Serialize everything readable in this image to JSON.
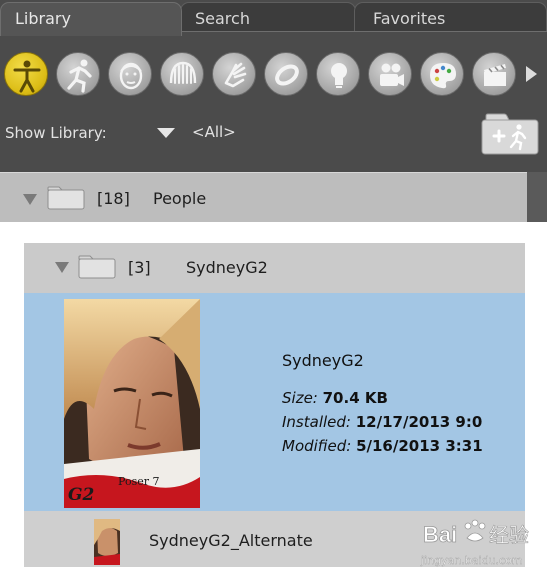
{
  "tabs": [
    {
      "label": "Library",
      "active": true
    },
    {
      "label": "Search",
      "active": false
    },
    {
      "label": "Favorites",
      "active": false
    }
  ],
  "categories": [
    {
      "name": "figures",
      "icon": "figure-icon",
      "active": true
    },
    {
      "name": "poses",
      "icon": "running-pose-icon",
      "active": false
    },
    {
      "name": "expressions",
      "icon": "face-icon",
      "active": false
    },
    {
      "name": "hair",
      "icon": "hair-icon",
      "active": false
    },
    {
      "name": "hands",
      "icon": "hand-icon",
      "active": false
    },
    {
      "name": "props",
      "icon": "ring-prop-icon",
      "active": false
    },
    {
      "name": "lights",
      "icon": "lightbulb-icon",
      "active": false
    },
    {
      "name": "cameras",
      "icon": "camera-icon",
      "active": false
    },
    {
      "name": "materials",
      "icon": "palette-icon",
      "active": false
    },
    {
      "name": "scenes",
      "icon": "clapperboard-icon",
      "active": false
    }
  ],
  "show_library": {
    "label": "Show Library:",
    "value": "<All>"
  },
  "people_folder": {
    "count": "[18]",
    "name": "People"
  },
  "sydney_folder": {
    "count": "[3]",
    "name": "SydneyG2"
  },
  "selected_item": {
    "name": "SydneyG2",
    "size_label": "Size",
    "size_value": "70.4 KB",
    "installed_label": "Installed",
    "installed_value": "12/17/2013 9:0",
    "modified_label": "Modified",
    "modified_value": "5/16/2013 3:31",
    "thumbnail_caption": "Poser 7",
    "thumbnail_logo": "G2"
  },
  "alternate_item": {
    "name": "SydneyG2_Alternate"
  },
  "watermark": {
    "brand": "Bai",
    "brand_cn": "经验",
    "url": "jingyan.baidu.com"
  },
  "colors": {
    "panel_dark": "#4b4b4b",
    "active_icon": "#dcbd16",
    "selection_blue": "#a3c6e4"
  }
}
